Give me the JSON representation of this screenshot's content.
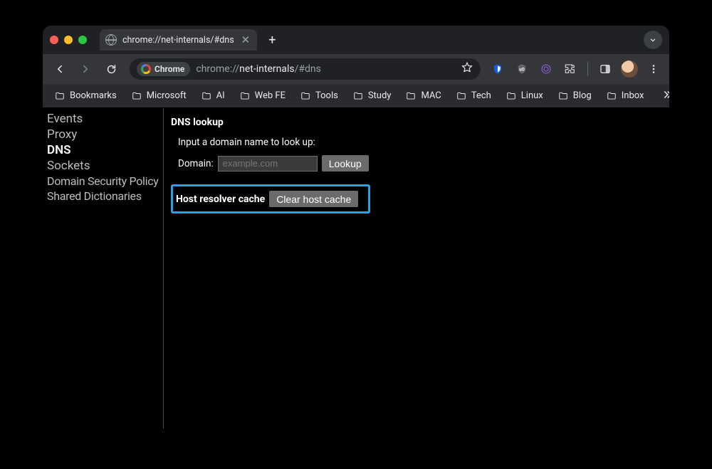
{
  "tab": {
    "title": "chrome://net-internals/#dns"
  },
  "toolbar": {
    "chip_label": "Chrome",
    "url_prefix": "chrome://",
    "url_main": "net-internals",
    "url_suffix": "/#dns"
  },
  "bookmarks": [
    "Bookmarks",
    "Microsoft",
    "AI",
    "Web FE",
    "Tools",
    "Study",
    "MAC",
    "Tech",
    "Linux",
    "Blog",
    "Inbox"
  ],
  "sidebar": {
    "items": [
      "Events",
      "Proxy",
      "DNS",
      "Sockets",
      "Domain Security Policy",
      "Shared Dictionaries"
    ],
    "active_index": 2
  },
  "main": {
    "heading": "DNS lookup",
    "prompt": "Input a domain name to look up:",
    "domain_label": "Domain:",
    "domain_placeholder": "example.com",
    "lookup_btn": "Lookup",
    "cache_label": "Host resolver cache",
    "clear_btn": "Clear host cache"
  }
}
